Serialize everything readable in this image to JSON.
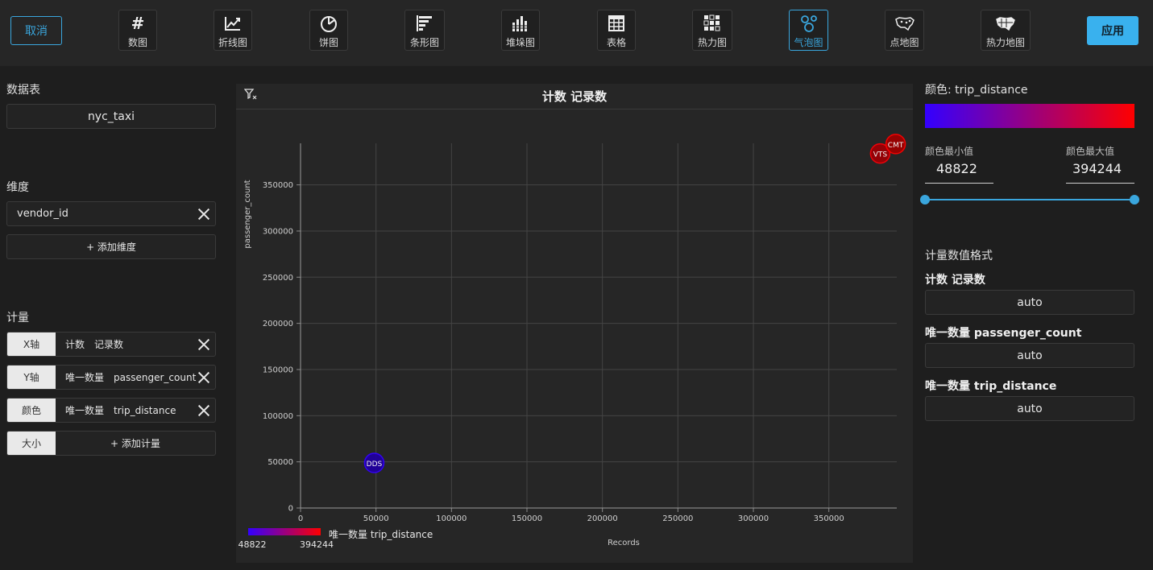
{
  "toolbar": {
    "cancel_label": "取消",
    "apply_label": "应用",
    "chart_types": [
      {
        "label": "数图",
        "icon": "hash-icon"
      },
      {
        "label": "折线图",
        "icon": "line-chart-icon"
      },
      {
        "label": "饼图",
        "icon": "pie-chart-icon"
      },
      {
        "label": "条形图",
        "icon": "bar-chart-icon"
      },
      {
        "label": "堆垛图",
        "icon": "stacked-chart-icon"
      },
      {
        "label": "表格",
        "icon": "table-icon"
      },
      {
        "label": "热力图",
        "icon": "heatmap-icon"
      },
      {
        "label": "气泡图",
        "icon": "bubble-chart-icon"
      },
      {
        "label": "点地图",
        "icon": "point-map-icon"
      },
      {
        "label": "热力地图",
        "icon": "choropleth-icon"
      }
    ],
    "active_chart": "气泡图"
  },
  "left": {
    "table_title": "数据表",
    "table_name": "nyc_taxi",
    "dimension_title": "维度",
    "dimension": "vendor_id",
    "add_dimension": "+ 添加维度",
    "measure_title": "计量",
    "measures": [
      {
        "tag": "X轴",
        "agg": "计数",
        "field": "记录数"
      },
      {
        "tag": "Y轴",
        "agg": "唯一数量",
        "field": "passenger_count"
      },
      {
        "tag": "颜色",
        "agg": "唯一数量",
        "field": "trip_distance"
      }
    ],
    "size_tag": "大小",
    "add_measure": "+ 添加计量"
  },
  "chart_data": {
    "type": "scatter",
    "title": "计数 记录数",
    "xlabel": "Records",
    "ylabel": "passenger_count",
    "xlim": [
      0,
      395000
    ],
    "ylim": [
      0,
      395000
    ],
    "xticks": [
      0,
      50000,
      100000,
      150000,
      200000,
      250000,
      300000,
      350000
    ],
    "yticks": [
      0,
      50000,
      100000,
      150000,
      200000,
      250000,
      300000,
      350000
    ],
    "points": [
      {
        "label": "DDS",
        "x": 48822,
        "y": 48822,
        "color_value": 48822
      },
      {
        "label": "VTS",
        "x": 384000,
        "y": 384000,
        "color_value": 384000
      },
      {
        "label": "CMT",
        "x": 394244,
        "y": 394244,
        "color_value": 394244
      }
    ],
    "color_scale": {
      "min": 48822,
      "max": 394244,
      "from": "#3300ff",
      "to": "#ff0000"
    },
    "legend": {
      "title": "唯一数量 trip_distance",
      "min_label": "48822",
      "max_label": "394244"
    }
  },
  "right": {
    "color_title": "颜色: trip_distance",
    "min_label": "颜色最小值",
    "max_label": "颜色最大值",
    "min_value": "48822",
    "max_value": "394244",
    "format_title": "计量数值格式",
    "formats": [
      {
        "title": "计数 记录数",
        "value": "auto"
      },
      {
        "title": "唯一数量 passenger_count",
        "value": "auto"
      },
      {
        "title": "唯一数量 trip_distance",
        "value": "auto"
      }
    ]
  }
}
